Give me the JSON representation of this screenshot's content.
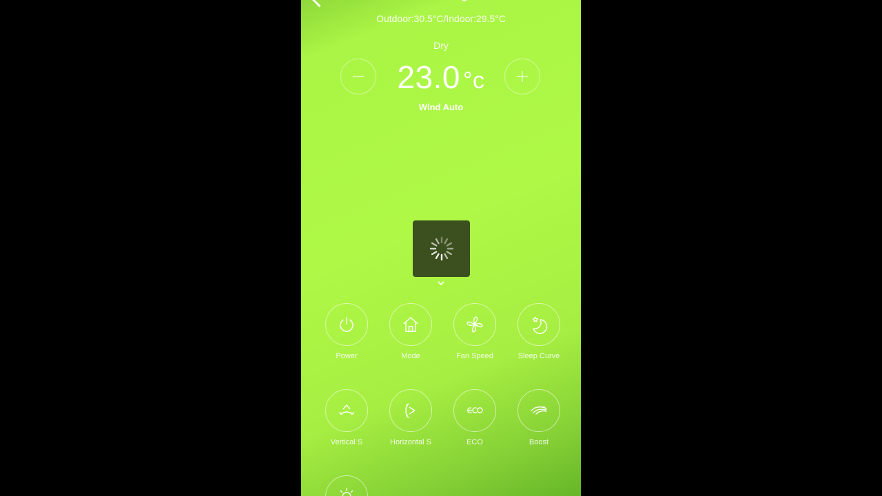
{
  "status": {
    "temperatures": "Outdoor:30.5°C/Indoor:29.5°C",
    "mode": "Dry",
    "setpoint": "23.0",
    "unit": "°c",
    "wind": "Wind Auto"
  },
  "controls": {
    "row1": [
      {
        "label": "Power",
        "icon": "power-icon"
      },
      {
        "label": "Mode",
        "icon": "home-icon"
      },
      {
        "label": "Fan Speed",
        "icon": "fan-icon"
      },
      {
        "label": "Sleep Curve",
        "icon": "moon-star-icon"
      }
    ],
    "row2": [
      {
        "label": "Vertical S",
        "icon": "vertical-swing-icon"
      },
      {
        "label": "Horizontal S",
        "icon": "horizontal-swing-icon"
      },
      {
        "label": "ECO",
        "icon": "eco-icon"
      },
      {
        "label": "Boost",
        "icon": "boost-icon"
      }
    ]
  },
  "colors": {
    "background_green": "#aff846",
    "loader_bg": "#3c4f1e",
    "foreground": "#ffffff"
  }
}
